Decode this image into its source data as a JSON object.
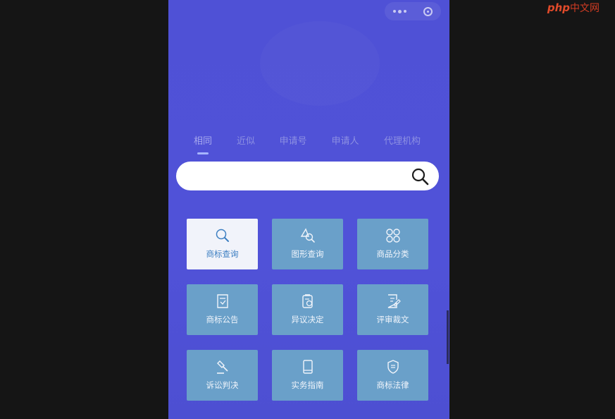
{
  "tabs": [
    "相同",
    "近似",
    "申请号",
    "申请人",
    "代理机构"
  ],
  "active_tab": "相同",
  "search": {
    "value": "",
    "placeholder": ""
  },
  "tiles": [
    {
      "label": "商标查询",
      "icon": "search-icon",
      "active": true
    },
    {
      "label": "图形查询",
      "icon": "shape-search-icon",
      "active": false
    },
    {
      "label": "商品分类",
      "icon": "category-grid-icon",
      "active": false
    },
    {
      "label": "商标公告",
      "icon": "announcement-icon",
      "active": false
    },
    {
      "label": "异议决定",
      "icon": "objection-decision-icon",
      "active": false
    },
    {
      "label": "评审裁文",
      "icon": "review-document-icon",
      "active": false
    },
    {
      "label": "诉讼判决",
      "icon": "gavel-icon",
      "active": false
    },
    {
      "label": "实务指南",
      "icon": "guide-book-icon",
      "active": false
    },
    {
      "label": "商标法律",
      "icon": "law-shield-icon",
      "active": false
    }
  ],
  "watermark": {
    "brand": "php",
    "suffix": "中文网"
  },
  "colors": {
    "background": "#5052d8",
    "tile": "#6aa0c9",
    "tile_active": "#f1f3fa",
    "tab_indicator": "#a7b5ff"
  }
}
